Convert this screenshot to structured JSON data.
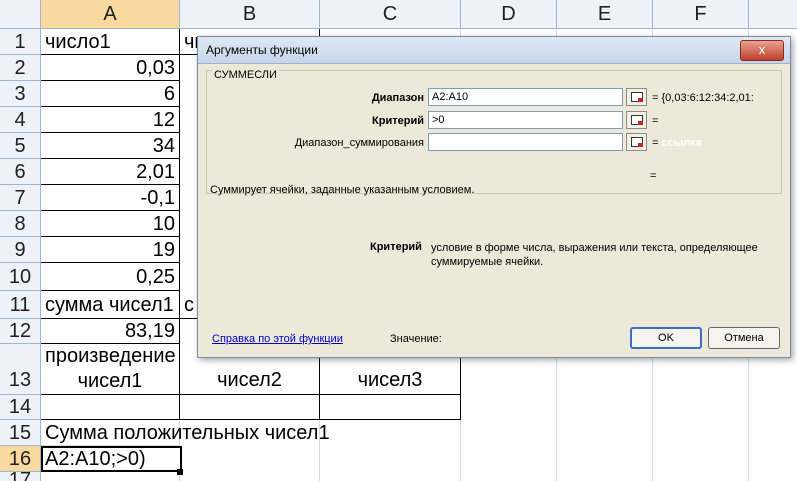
{
  "columns": [
    "A",
    "B",
    "C",
    "D",
    "E",
    "F"
  ],
  "rows": [
    "1",
    "2",
    "3",
    "4",
    "5",
    "6",
    "7",
    "8",
    "9",
    "10",
    "11",
    "12",
    "13",
    "14",
    "15",
    "16",
    "17"
  ],
  "cells": {
    "A1": "число1",
    "B1": "чи",
    "A2": "0,03",
    "A3": "6",
    "A4": "12",
    "A5": "34",
    "A6": "2,01",
    "A7": "-0,1",
    "A8": "10",
    "A9": "19",
    "A10": "0,25",
    "A11": "сумма чисел1",
    "B11": "с",
    "A12": "83,19",
    "A13": "произведение чисел1",
    "B13_visible": "чисел2",
    "C13_visible": "чисел3",
    "A15": "Сумма положительных чисел1",
    "A16": "A2:A10;>0)"
  },
  "dialog": {
    "title": "Аргументы функции",
    "close_label": "x",
    "function_name": "СУММЕСЛИ",
    "args": [
      {
        "label": "Диапазон",
        "value": "A2:A10",
        "result": "= {0,03:6:12:34:2,01:"
      },
      {
        "label": "Критерий",
        "value": ">0",
        "result": "="
      },
      {
        "label": "Диапазон_суммирования",
        "value": "",
        "result": "=",
        "hint": "ссылка"
      }
    ],
    "function_result": "=",
    "description": "Суммирует ячейки, заданные указанным условием.",
    "arg_help_name": "Критерий",
    "arg_help_text": "условие в форме числа, выражения или текста, определяющее суммируемые ячейки.",
    "help_link": "Справка по этой функции",
    "value_label": "Значение:",
    "ok_label": "OK",
    "cancel_label": "Отмена"
  }
}
